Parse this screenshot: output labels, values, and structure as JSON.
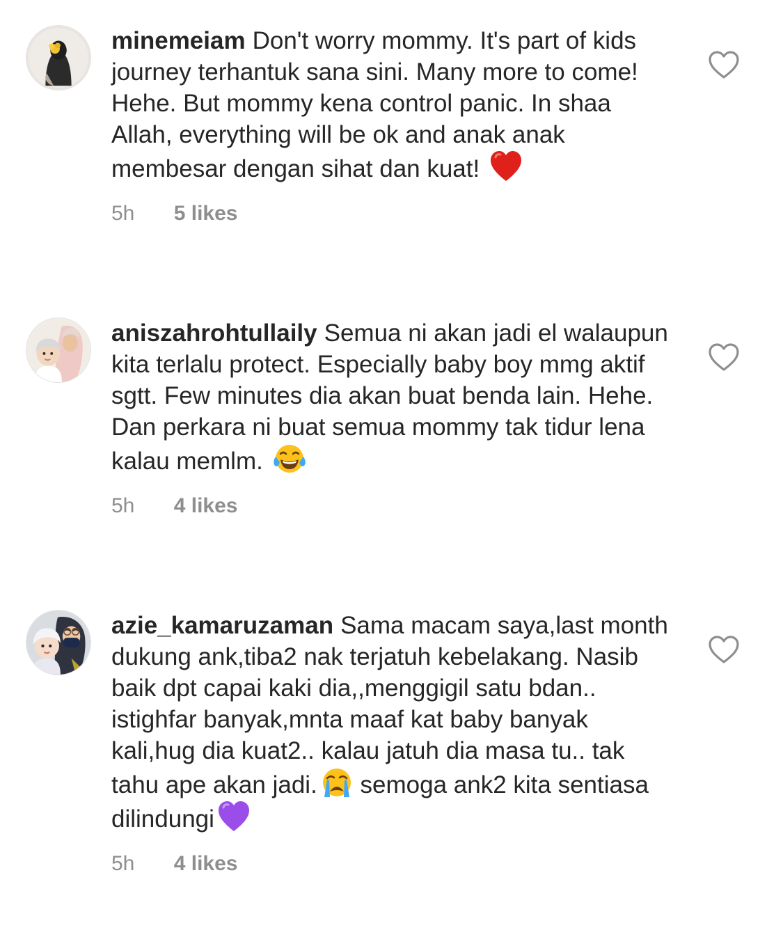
{
  "comments": [
    {
      "username": "minemeiam",
      "text": "Don't worry mommy. It's part of kids journey terhantuk sana sini. Many more to come! Hehe. But mommy kena control panic. In shaa Allah, everything will be ok and anak anak membesar dengan sihat dan kuat! ",
      "emoji": "red-heart-emoji",
      "time": "5h",
      "likes": "5 likes",
      "avatar_icon": "profile-photo-hijab-flower"
    },
    {
      "username": "aniszahrohtullaily",
      "text": "Semua ni akan jadi el walaupun kita terlalu protect. Especially baby boy mmg aktif sgtt.  Few minutes dia akan buat benda lain. Hehe. Dan perkara ni buat semua mommy tak tidur lena kalau memlm. ",
      "emoji": "tears-of-joy-emoji",
      "time": "5h",
      "likes": "4 likes",
      "avatar_icon": "profile-photo-mother-baby"
    },
    {
      "username": "azie_kamaruzaman",
      "text": "Sama macam saya,last month dukung ank,tiba2 nak terjatuh kebelakang. Nasib baik dpt capai kaki dia,,menggigil satu bdan.. istighfar banyak,mnta maaf kat baby banyak kali,hug dia kuat2.. kalau jatuh dia masa tu.. tak tahu ape akan jadi.",
      "text_after": " semoga ank2 kita sentiasa dilindungi",
      "emoji": "crying-face-emoji",
      "emoji_end": "purple-heart-emoji",
      "time": "5h",
      "likes": "4 likes",
      "avatar_icon": "profile-photo-family-masks"
    }
  ],
  "colors": {
    "text": "#262626",
    "meta": "#8e8e8e",
    "heart_outline": "#8e8e8e",
    "red_heart": "#e0201b",
    "purple_heart": "#9b4dea",
    "emoji_yellow": "#fcc21b"
  }
}
